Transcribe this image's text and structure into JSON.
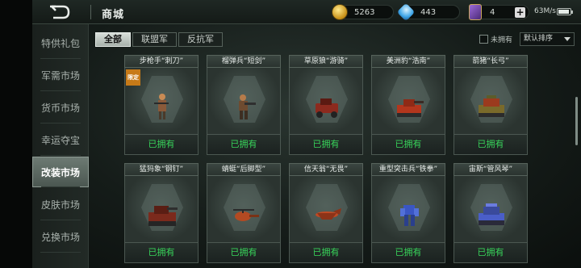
{
  "header": {
    "title": "商城",
    "gold": "5263",
    "gems": "443",
    "tickets": "4",
    "network": "63M/s",
    "battery_level": 0.9
  },
  "sidebar": {
    "items": [
      {
        "label": "特供礼包"
      },
      {
        "label": "军需市场"
      },
      {
        "label": "货币市场"
      },
      {
        "label": "幸运夺宝"
      },
      {
        "label": "改装市场"
      },
      {
        "label": "皮肤市场"
      },
      {
        "label": "兑换市场"
      }
    ],
    "active_index": 4
  },
  "filters": {
    "tabs": [
      {
        "label": "全部"
      },
      {
        "label": "联盟军"
      },
      {
        "label": "反抗军"
      }
    ],
    "owned_only_label": "未拥有",
    "sort_label": "默认排序"
  },
  "items": [
    {
      "name": "步枪手“刺刀”",
      "status": "已拥有",
      "badge": "限定",
      "icon": "rifleman-icon"
    },
    {
      "name": "榴弹兵“短剑”",
      "status": "已拥有",
      "icon": "grenadier-icon"
    },
    {
      "name": "草原狼“游骑”",
      "status": "已拥有",
      "icon": "wolf-vehicle-icon"
    },
    {
      "name": "美洲豹“浩南”",
      "status": "已拥有",
      "icon": "jaguar-tank-icon"
    },
    {
      "name": "箭猪“长弓”",
      "status": "已拥有",
      "icon": "porcupine-tank-icon"
    },
    {
      "name": "猛犸象“钢钉”",
      "status": "已拥有",
      "icon": "mammoth-tank-icon"
    },
    {
      "name": "蜻蜓“后脚型”",
      "status": "已拥有",
      "icon": "dragonfly-heli-icon"
    },
    {
      "name": "信天翁“无畏”",
      "status": "已拥有",
      "icon": "albatross-plane-icon"
    },
    {
      "name": "重型突击兵“铁拳”",
      "status": "已拥有",
      "icon": "heavy-trooper-icon"
    },
    {
      "name": "宙斯“管风琴”",
      "status": "已拥有",
      "icon": "zeus-tank-icon"
    }
  ]
}
